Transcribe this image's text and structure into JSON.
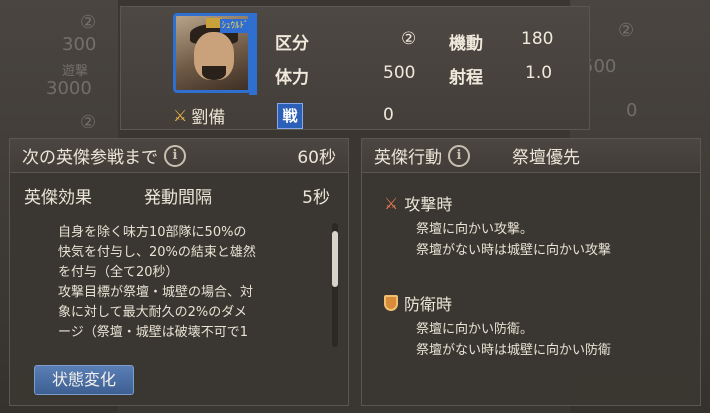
{
  "background": {
    "left": [
      "②",
      "300",
      "遊撃",
      "3000",
      "②",
      "0"
    ],
    "right": [
      "②",
      "500",
      "0"
    ]
  },
  "hero": {
    "name": "劉備",
    "portrait_badge": "ｼｭｳﾙﾄﾞ",
    "stats": {
      "category_label": "区分",
      "category_value": "②",
      "mobility_label": "機動",
      "mobility_value": "180",
      "hp_label": "体力",
      "hp_value": "500",
      "range_label": "射程",
      "range_value": "1.0"
    },
    "battle_icon": "戦",
    "battle_value": "0"
  },
  "left_panel": {
    "title": "次の英傑参戦まで",
    "timer": "60秒",
    "effect_label": "英傑効果",
    "interval_label": "発動間隔",
    "interval_value": "5秒",
    "effect_lines": [
      "自身を除く味方10部隊に50%の",
      "快気を付与し、20%の結束と雄然",
      "を付与（全て20秒）",
      "攻撃目標が祭壇・城壁の場合、対",
      "象に対して最大耐久の2%のダメ",
      "ージ（祭壇・城壁は破壊不可で1"
    ],
    "status_button": "状態変化"
  },
  "right_panel": {
    "title": "英傑行動",
    "priority": "祭壇優先",
    "attack": {
      "title": "攻撃時",
      "lines": [
        "祭壇に向かい攻撃。",
        "祭壇がない時は城壁に向かい攻撃"
      ]
    },
    "defend": {
      "title": "防衛時",
      "lines": [
        "祭壇に向かい防衛。",
        "祭壇がない時は城壁に向かい防衛"
      ]
    }
  }
}
